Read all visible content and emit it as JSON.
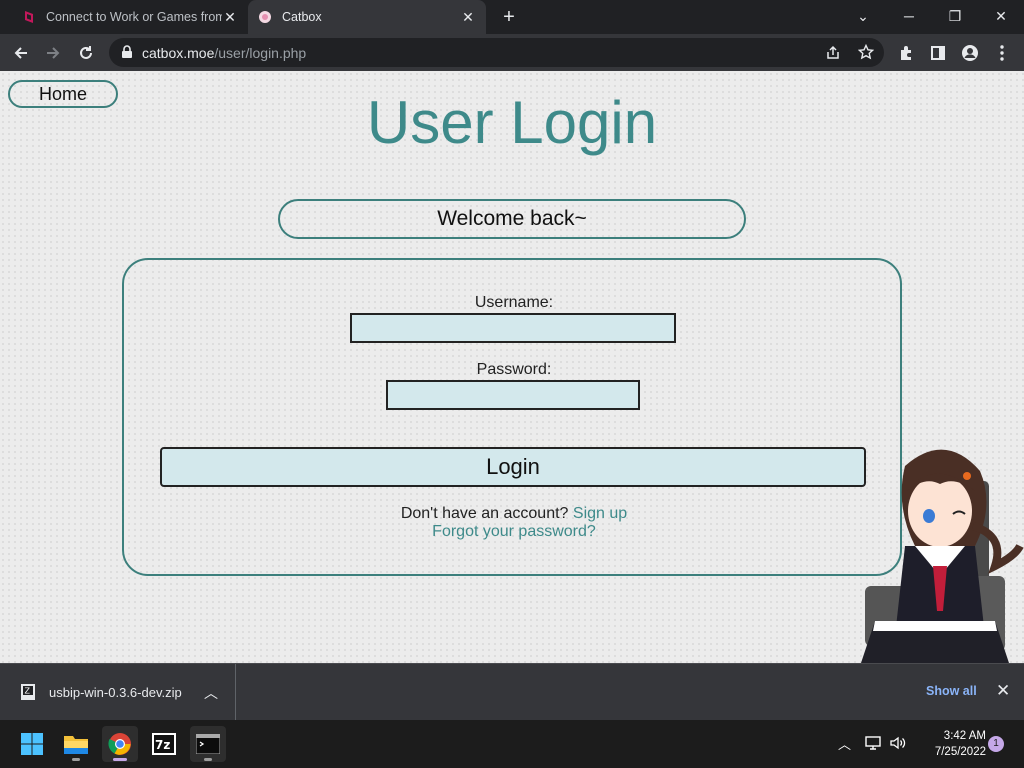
{
  "browser": {
    "tabs": [
      {
        "title": "Connect to Work or Games from",
        "active": false
      },
      {
        "title": "Catbox",
        "active": true
      }
    ],
    "url_host": "catbox.moe",
    "url_path": "/user/login.php"
  },
  "page": {
    "home_label": "Home",
    "title": "User Login",
    "welcome": "Welcome back~",
    "username_label": "Username:",
    "password_label": "Password:",
    "username_value": "",
    "password_value": "",
    "login_label": "Login",
    "signup_prompt": "Don't have an account?",
    "signup_link": "Sign up",
    "forgot_link": "Forgot your password?"
  },
  "downloads": {
    "file_name": "usbip-win-0.3.6-dev.zip",
    "show_all": "Show all"
  },
  "taskbar": {
    "time": "3:42 AM",
    "date": "7/25/2022",
    "notifications": "1"
  },
  "colors": {
    "accent": "#3e8a8a",
    "field_bg": "#d3e8ec",
    "page_bg": "#ececec",
    "browser_dark": "#202124"
  }
}
